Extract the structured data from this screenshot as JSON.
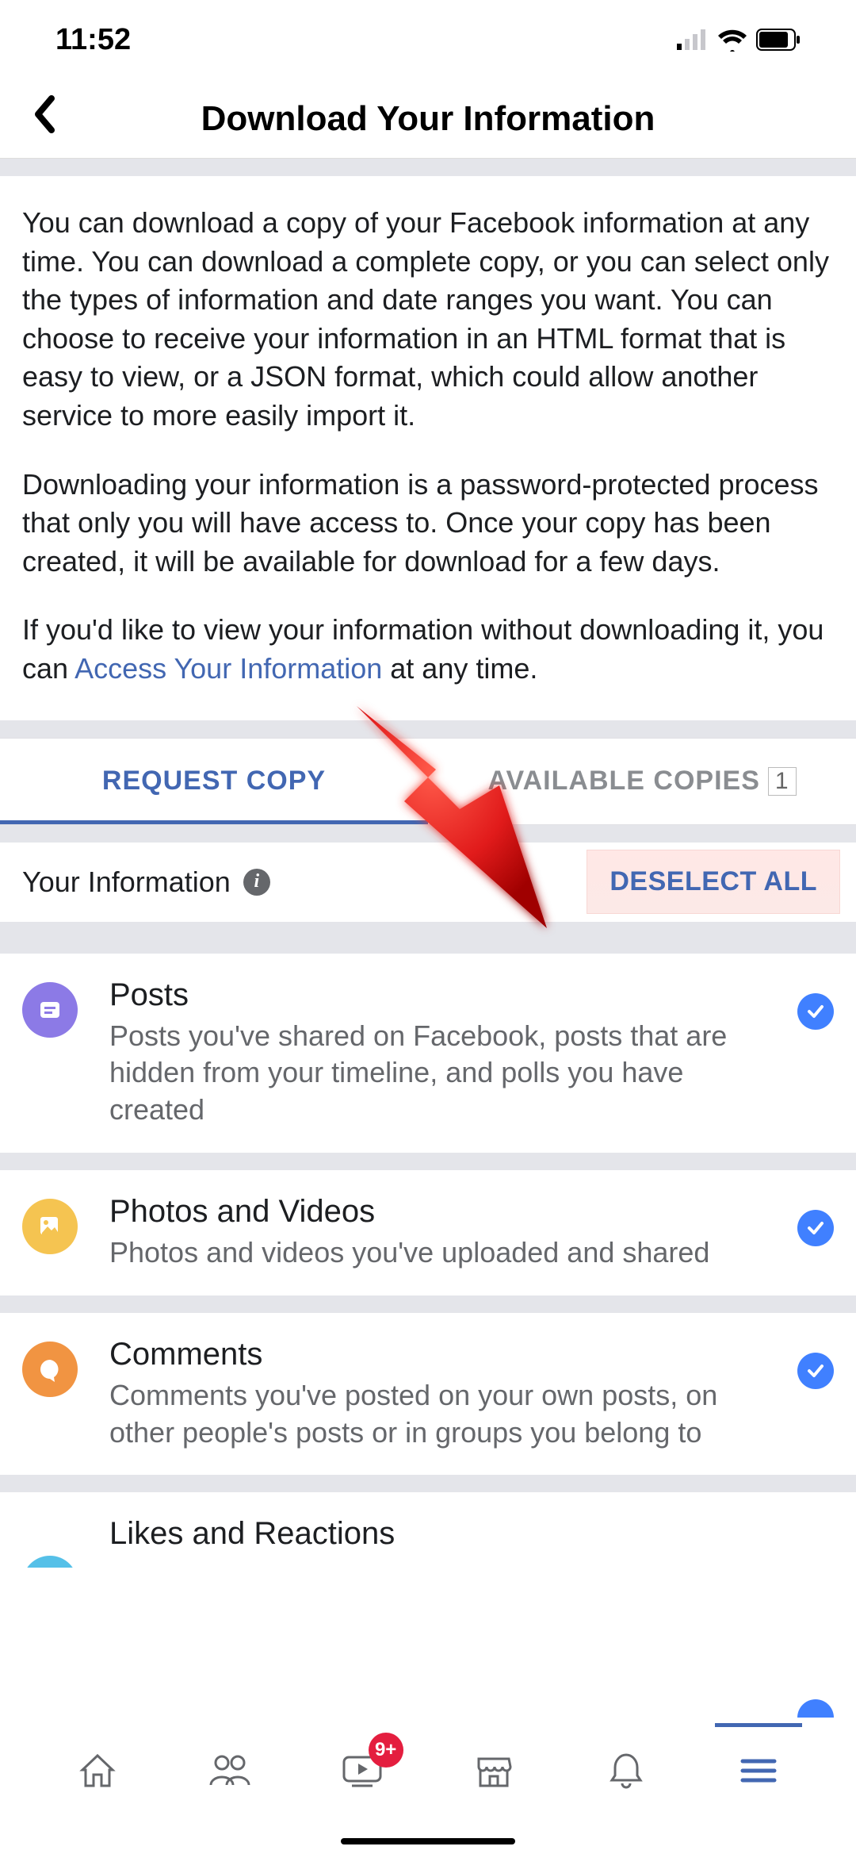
{
  "status": {
    "time": "11:52"
  },
  "header": {
    "title": "Download Your Information"
  },
  "intro": {
    "p1": "You can download a copy of your Facebook information at any time. You can download a complete copy, or you can select only the types of information and date ranges you want. You can choose to receive your information in an HTML format that is easy to view, or a JSON format, which could allow another service to more easily import it.",
    "p2": "Downloading your information is a password-protected process that only you will have access to. Once your copy has been created, it will be available for download for a few days.",
    "p3_a": "If you'd like to view your information without downloading it, you can ",
    "p3_link": "Access Your Information",
    "p3_b": " at any time."
  },
  "tabs": {
    "request": "REQUEST COPY",
    "available": "AVAILABLE COPIES",
    "count": "1"
  },
  "section": {
    "title": "Your Information",
    "deselect": "DESELECT ALL"
  },
  "items": [
    {
      "title": "Posts",
      "desc": "Posts you've shared on Facebook, posts that are hidden from your timeline, and polls you have created"
    },
    {
      "title": "Photos and Videos",
      "desc": "Photos and videos you've uploaded and shared"
    },
    {
      "title": "Comments",
      "desc": "Comments you've posted on your own posts, on other people's posts or in groups you belong to"
    },
    {
      "title": "Likes and Reactions",
      "desc": ""
    }
  ],
  "nav": {
    "badge": "9+"
  }
}
